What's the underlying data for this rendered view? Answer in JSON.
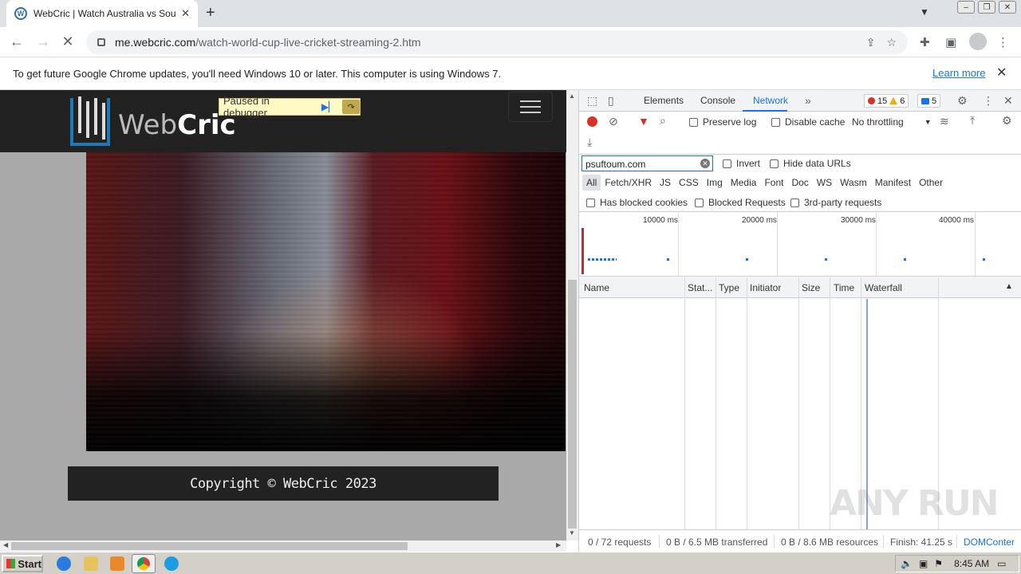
{
  "browser": {
    "tab_title": "WebCric | Watch Australia vs South",
    "tab_favicon": "wordpress-icon",
    "url_host": "me.webcric.com",
    "url_path": "/watch-world-cup-live-cricket-streaming-2.htm",
    "infobar_text": "To get future Google Chrome updates, you'll need Windows 10 or later. This computer is using Windows 7.",
    "infobar_link": "Learn more"
  },
  "page": {
    "logo_light": "Web",
    "logo_bold": "Cric",
    "debugger_label": "Paused in debugger",
    "footer_text": "Copyright © WebCric 2023"
  },
  "devtools": {
    "tabs": [
      "Elements",
      "Console",
      "Network"
    ],
    "active_tab": "Network",
    "errors": "15",
    "warnings": "6",
    "messages": "5",
    "preserve_log": "Preserve log",
    "disable_cache": "Disable cache",
    "throttling": "No throttling",
    "filter_value": "psuftoum.com",
    "invert": "Invert",
    "hide_data_urls": "Hide data URLs",
    "types": [
      "All",
      "Fetch/XHR",
      "JS",
      "CSS",
      "Img",
      "Media",
      "Font",
      "Doc",
      "WS",
      "Wasm",
      "Manifest",
      "Other"
    ],
    "has_blocked_cookies": "Has blocked cookies",
    "blocked_requests": "Blocked Requests",
    "third_party": "3rd-party requests",
    "timeline_ticks": [
      "10000 ms",
      "20000 ms",
      "30000 ms",
      "40000 ms"
    ],
    "columns": [
      "Name",
      "Stat...",
      "Type",
      "Initiator",
      "Size",
      "Time",
      "Waterfall"
    ],
    "status": {
      "requests": "0 / 72 requests",
      "transferred": "0 B / 6.5 MB transferred",
      "resources": "0 B / 8.6 MB resources",
      "finish": "Finish: 41.25 s",
      "domcontent": "DOMConter"
    }
  },
  "watermark": "ANY RUN",
  "taskbar": {
    "start_label": "Start",
    "clock": "8:45 AM"
  }
}
